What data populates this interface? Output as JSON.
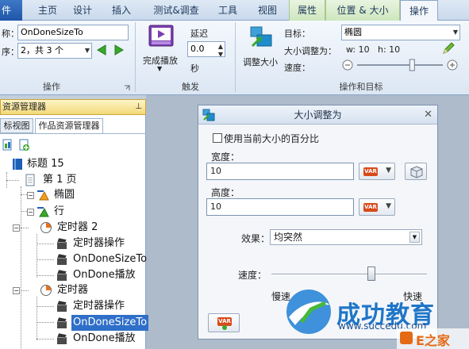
{
  "ribbon_tabs": [
    {
      "label": "主页"
    },
    {
      "label": "设计"
    },
    {
      "label": "插入"
    },
    {
      "label": "测试&调查"
    },
    {
      "label": "工具"
    },
    {
      "label": "视图"
    },
    {
      "label": "属性"
    },
    {
      "label": "位置 & 大小"
    },
    {
      "label": "操作"
    }
  ],
  "file_tab_fragment": "件",
  "ribbon": {
    "name_label": "称：",
    "name_value": "OnDoneSizeTo",
    "order_label": "序：",
    "order_value": "2，共 3 个",
    "group1_label": "操作",
    "complete_play_label": "完成播放",
    "delay_label": "延迟",
    "delay_value": "0.0",
    "delay_unit": "秒",
    "group2_label": "触发",
    "adjust_size_label": "调整大小",
    "target_label": "目标：",
    "target_value": "椭圆",
    "resize_to_label": "大小调整为：",
    "resize_w": "w: 10",
    "resize_h": "h: 10",
    "speed_label": "速度：",
    "speed_level": 0.65,
    "group3_label": "操作和目标"
  },
  "left_panel": {
    "title": "资源管理器",
    "tabs": [
      {
        "label": "标视图"
      },
      {
        "label": "作品资源管理器"
      }
    ],
    "tree": [
      {
        "label": "标题 15"
      },
      {
        "label": "第 1 页"
      },
      {
        "label": "椭圆"
      },
      {
        "label": "行"
      },
      {
        "label": "定时器 2"
      },
      {
        "label": "定时器操作"
      },
      {
        "label": "OnDoneSizeTo"
      },
      {
        "label": "OnDone播放"
      },
      {
        "label": "定时器"
      },
      {
        "label": "定时器操作"
      },
      {
        "label": "OnDoneSizeTo"
      },
      {
        "label": "OnDone播放"
      }
    ]
  },
  "dialog": {
    "title": "大小调整为",
    "checkbox_label": "使用当前大小的百分比",
    "width_label": "宽度：",
    "width_value": "10",
    "height_label": "高度：",
    "height_value": "10",
    "var_label": "VAR",
    "effect_label": "效果：",
    "effect_value": "均突然",
    "speed_label": "速度：",
    "speed_level": 0.65,
    "slow_label": "慢速",
    "fast_label": "快速"
  },
  "watermark": {
    "brand": "成功教育",
    "url": "www.succedu.com",
    "corner": "E之家"
  },
  "colors": {
    "accent": "#2f6fc9",
    "context_tab": "#cfe6bf",
    "play_purple": "#7a3fb0",
    "arrow_green": "#3aa82b"
  }
}
